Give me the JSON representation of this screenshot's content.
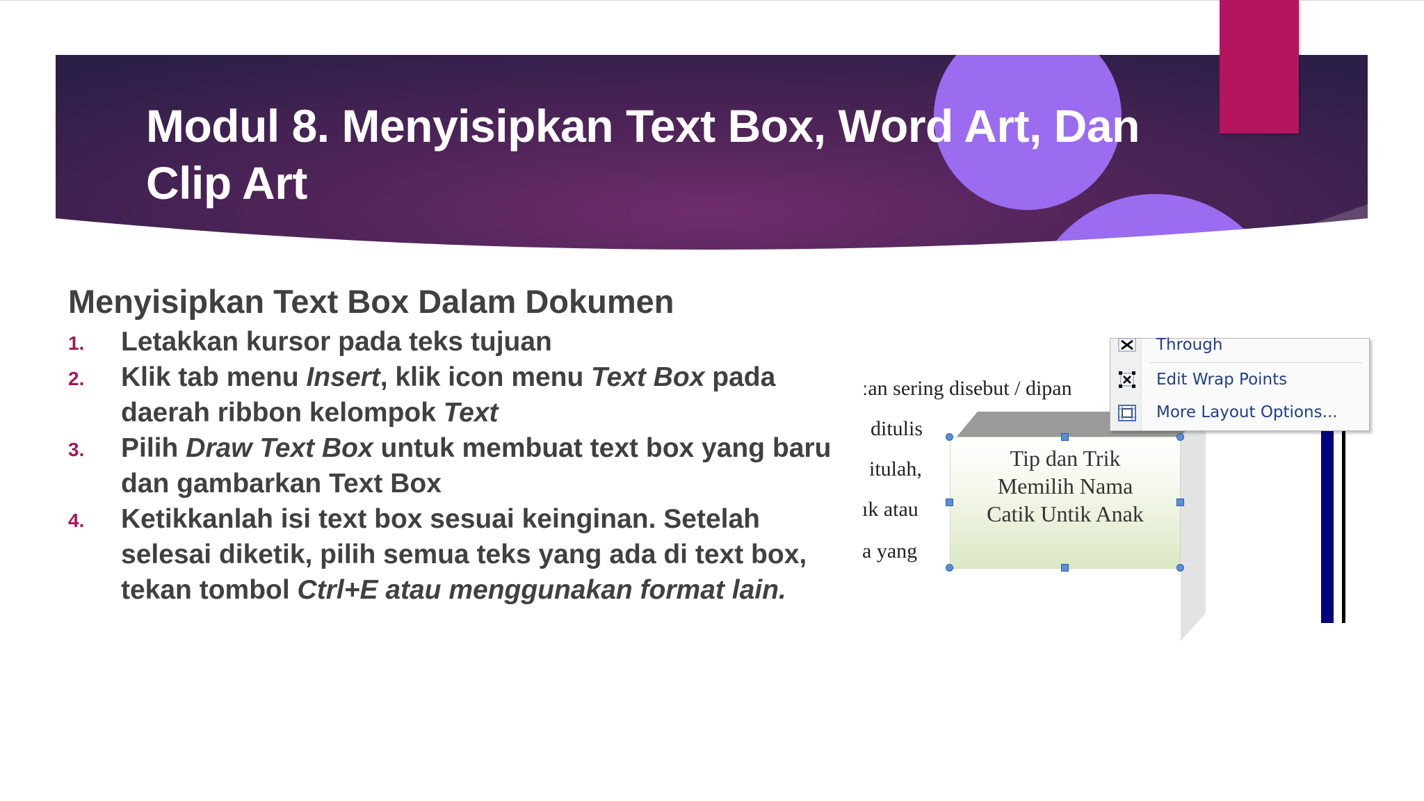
{
  "slide": {
    "title": "Modul 8. Menyisipkan Text Box, Word Art, Dan Clip Art"
  },
  "content": {
    "subtitle": "Menyisipkan Text Box Dalam Dokumen",
    "steps": [
      {
        "num": "1.",
        "parts": [
          {
            "text": "Letakkan kursor pada teks tujuan",
            "italic": false
          }
        ]
      },
      {
        "num": "2.",
        "parts": [
          {
            "text": "Klik tab menu ",
            "italic": false
          },
          {
            "text": "Insert",
            "italic": true
          },
          {
            "text": ", klik icon menu ",
            "italic": false
          },
          {
            "text": "Text Box",
            "italic": true
          },
          {
            "text": " pada daerah ribbon kelompok ",
            "italic": false
          },
          {
            "text": "Text",
            "italic": true
          }
        ]
      },
      {
        "num": "3.",
        "parts": [
          {
            "text": "Pilih ",
            "italic": false
          },
          {
            "text": "Draw Text Box",
            "italic": true
          },
          {
            "text": " untuk membuat text box yang baru dan gambarkan Text Box",
            "italic": false
          }
        ]
      },
      {
        "num": "4.",
        "parts": [
          {
            "text": "Ketikkanlah isi text box sesuai keinginan. Setelah selesai diketik, pilih semua teks yang ada di text box, tekan tombol ",
            "italic": false
          },
          {
            "text": "Ctrl+E atau menggunakan format lain.",
            "italic": true
          }
        ]
      }
    ]
  },
  "screenshot": {
    "doc_lines": [
      "ːan  sering  disebut  /  dipan",
      "ditulis",
      "itulah,",
      "ık atau",
      "a  yang"
    ],
    "textbox_lines": [
      "Tip dan Trik",
      "Memilih Nama",
      "Catik Untik Anak"
    ],
    "menu_items": [
      {
        "label": "Through",
        "icon": "wrap-through-icon"
      },
      {
        "label": "Edit Wrap Points",
        "icon": "edit-wrap-points-icon"
      },
      {
        "label": "More Layout Options...",
        "icon": "layout-options-icon"
      }
    ]
  },
  "colors": {
    "banner_dark": "#2c1f47",
    "banner_mid": "#6f2d6e",
    "circle": "#9b6cf0",
    "accent": "#b5145f",
    "step_number": "#a3195b",
    "body_text": "#404040"
  }
}
